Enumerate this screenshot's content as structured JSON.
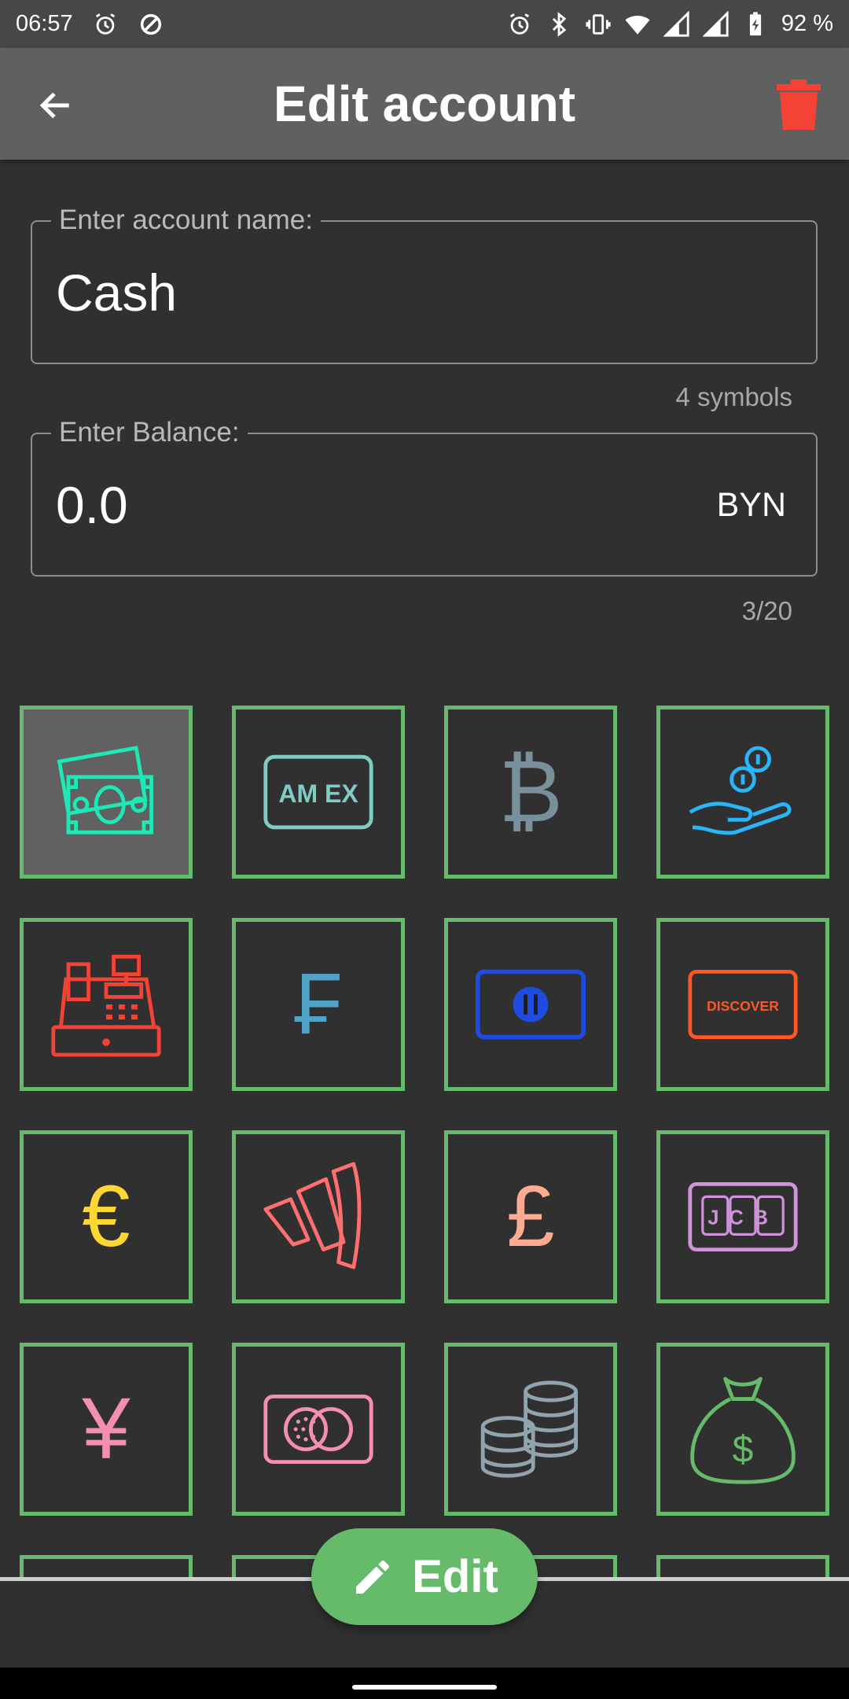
{
  "status_bar": {
    "time": "06:57",
    "battery": "92 %",
    "left_icons": [
      "alarm-icon",
      "data-saver-icon"
    ],
    "right_icons": [
      "alarm-icon",
      "bluetooth-icon",
      "vibrate-icon",
      "wifi-icon",
      "signal-icon",
      "signal-icon",
      "battery-charging-icon"
    ]
  },
  "app_bar": {
    "title": "Edit account",
    "back_icon": "arrow-back-icon",
    "delete_icon": "trash-icon",
    "delete_color": "#f44336"
  },
  "account_name": {
    "label": "Enter account name:",
    "value": "Cash",
    "helper": "4 symbols"
  },
  "balance": {
    "label": "Enter Balance:",
    "value": "0.0",
    "currency": "BYN",
    "counter": "3/20"
  },
  "icons": {
    "border_color": "#66bb6a",
    "selected_index": 0,
    "items": [
      {
        "name": "banknotes-icon",
        "color": "#1de9b6"
      },
      {
        "name": "amex-card-icon",
        "color": "#80cbc4",
        "text": "AM EX"
      },
      {
        "name": "bitcoin-icon",
        "color": "#78909c",
        "text": "₿"
      },
      {
        "name": "hand-coins-icon",
        "color": "#29b6f6"
      },
      {
        "name": "cash-register-icon",
        "color": "#f44336"
      },
      {
        "name": "franc-icon",
        "color": "#4fa3c7",
        "text": "₣"
      },
      {
        "name": "diners-club-card-icon",
        "color": "#1e4ce0"
      },
      {
        "name": "discover-card-icon",
        "color": "#ff5722",
        "text": "DISCOVER"
      },
      {
        "name": "euro-icon",
        "color": "#fdd835",
        "text": "€"
      },
      {
        "name": "wallet-w-icon",
        "color": "#ff6f6f"
      },
      {
        "name": "pound-icon",
        "color": "#ffab91",
        "text": "£"
      },
      {
        "name": "jcb-card-icon",
        "color": "#ce93d8",
        "text": "JCB"
      },
      {
        "name": "yen-icon",
        "color": "#f48fb1",
        "text": "¥"
      },
      {
        "name": "mastercard-icon",
        "color": "#f48fb1"
      },
      {
        "name": "coin-stacks-icon",
        "color": "#90a4ae"
      },
      {
        "name": "money-bag-icon",
        "color": "#66bb6a",
        "text": "$"
      }
    ]
  },
  "fab": {
    "label": "Edit",
    "icon": "pencil-icon"
  }
}
